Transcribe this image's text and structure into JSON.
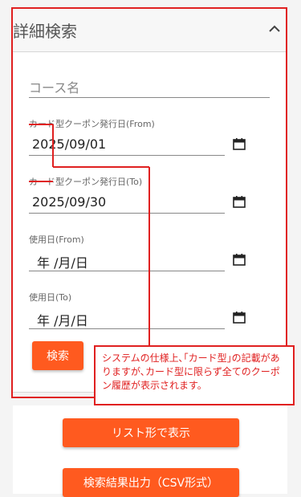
{
  "panel": {
    "title": "詳細検索"
  },
  "fields": {
    "course": {
      "placeholder": "コース名"
    },
    "issue_from": {
      "label": "カード型クーポン発行日(From)",
      "value": "2025/09/01"
    },
    "issue_to": {
      "label": "カード型クーポン発行日(To)",
      "value": "2025/09/30"
    },
    "use_from": {
      "label": "使用日(From)",
      "value": "年 /月/日"
    },
    "use_to": {
      "label": "使用日(To)",
      "value": "年 /月/日"
    }
  },
  "buttons": {
    "search": "検索",
    "list_view": "リスト形で表示",
    "csv_export": "検索結果出力（CSV形式）"
  },
  "annotation": {
    "note": "システムの仕様上､｢カード型｣の記載がありますが､カード型に限らず全てのクーポン履歴が表示されます。"
  },
  "colors": {
    "accent": "#ff5a1f",
    "annotation": "#e02020"
  }
}
